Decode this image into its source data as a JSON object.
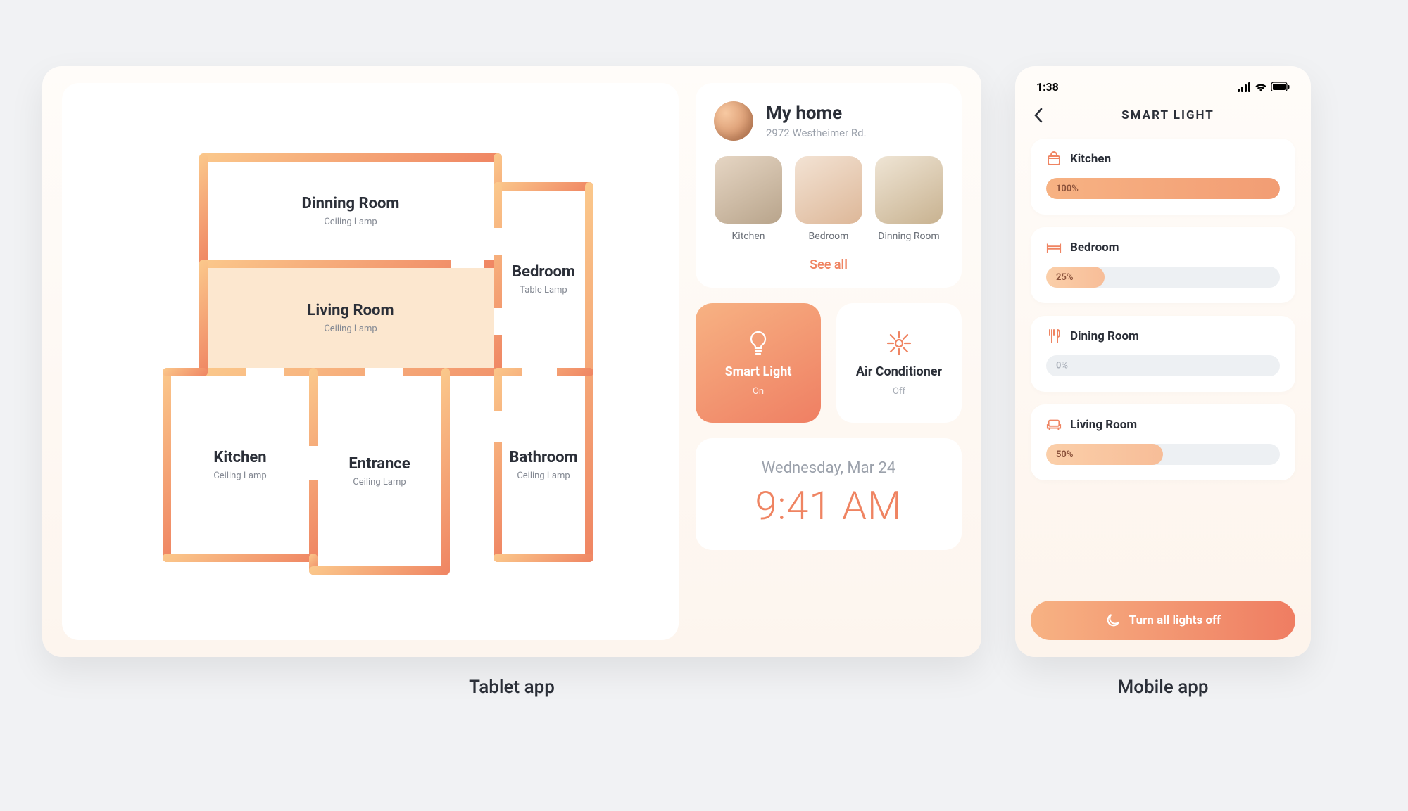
{
  "captions": {
    "tablet": "Tablet app",
    "mobile": "Mobile app"
  },
  "tablet": {
    "floorplan": {
      "rooms": [
        {
          "name": "Dinning Room",
          "sub": "Ceiling Lamp"
        },
        {
          "name": "Bedroom",
          "sub": "Table Lamp"
        },
        {
          "name": "Living Room",
          "sub": "Ceiling Lamp",
          "active": true
        },
        {
          "name": "Bathroom",
          "sub": "Ceiling Lamp"
        },
        {
          "name": "Kitchen",
          "sub": "Ceiling Lamp"
        },
        {
          "name": "Entrance",
          "sub": "Ceiling Lamp"
        }
      ]
    },
    "home": {
      "title": "My home",
      "address": "2972 Westheimer Rd.",
      "thumbs": [
        "Kitchen",
        "Bedroom",
        "Dinning Room"
      ],
      "see_all": "See all"
    },
    "tiles": {
      "smart_light": {
        "title": "Smart Light",
        "state": "On"
      },
      "air": {
        "title": "Air Conditioner",
        "state": "Off"
      }
    },
    "clock": {
      "date": "Wednesday, Mar 24",
      "time": "9:41 AM"
    }
  },
  "mobile": {
    "status_time": "1:38",
    "title": "SMART LIGHT",
    "sliders": [
      {
        "label": "Kitchen",
        "icon": "cook",
        "percent": 100
      },
      {
        "label": "Bedroom",
        "icon": "bed",
        "percent": 25
      },
      {
        "label": "Dining Room",
        "icon": "fork",
        "percent": 0
      },
      {
        "label": "Living Room",
        "icon": "couch",
        "percent": 50
      }
    ],
    "cta": "Turn all lights off"
  }
}
